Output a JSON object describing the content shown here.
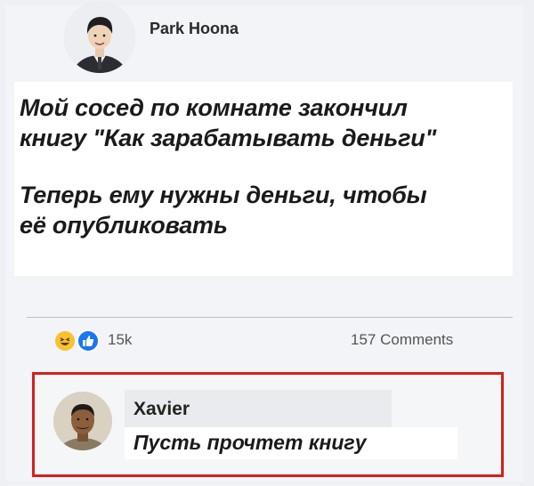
{
  "post": {
    "author": "Park Hoona",
    "lines": [
      "Мой сосед по комнате закончил",
      "книгу \"Как зарабатывать деньги\"",
      "Теперь ему нужны деньги, чтобы",
      "её опубликовать"
    ]
  },
  "engagement": {
    "reactions_count": "15k",
    "reaction_icons": [
      "laughing-face-icon",
      "like-thumb-icon"
    ],
    "comments_count": "157 Comments"
  },
  "comment": {
    "author": "Xavier",
    "text": "Пусть прочтет книгу"
  },
  "colors": {
    "highlight_border": "#d4201b",
    "like_blue": "#1877f2",
    "haha_yellow": "#f7c22e"
  }
}
